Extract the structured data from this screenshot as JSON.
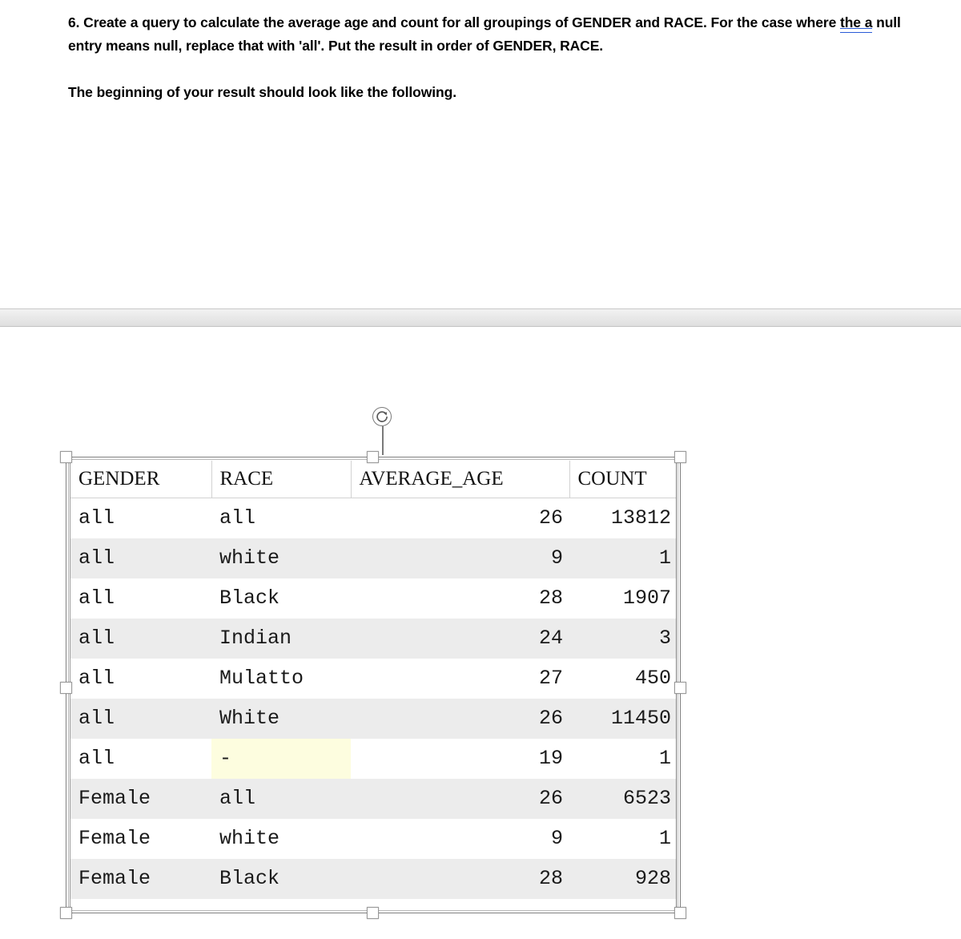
{
  "document": {
    "paragraph_1_part_a": "6.  Create a query to calculate the average age and count for all groupings of GENDER and RACE.  For the case where ",
    "grammar_flagged_text": "the a",
    "paragraph_1_part_b": " null entry means null, replace that with 'all'.  Put the result in order of GENDER, RACE.",
    "paragraph_2": "The beginning of your result should look like the following."
  },
  "selection": {
    "rotate_handle_label": "rotate-handle",
    "handles": [
      "top-left",
      "top-center",
      "top-right",
      "middle-left",
      "middle-right",
      "bottom-left",
      "bottom-center",
      "bottom-right"
    ]
  },
  "colors": {
    "null_highlight": "#fdfddf",
    "row_shade": "#ececec",
    "grammar_underline": "#2a5bd7",
    "selection_border": "#7f7f7f",
    "page_break_band": "#e7e7e7"
  },
  "table": {
    "columns": [
      "GENDER",
      "RACE",
      "AVERAGE_AGE",
      "COUNT"
    ],
    "rows": [
      {
        "gender": "all",
        "race": "all",
        "average_age": "26",
        "count": "13812",
        "race_null_highlight": false
      },
      {
        "gender": "all",
        "race": "white",
        "average_age": "9",
        "count": "1",
        "race_null_highlight": false
      },
      {
        "gender": "all",
        "race": "Black",
        "average_age": "28",
        "count": "1907",
        "race_null_highlight": false
      },
      {
        "gender": "all",
        "race": "Indian",
        "average_age": "24",
        "count": "3",
        "race_null_highlight": false
      },
      {
        "gender": "all",
        "race": "Mulatto",
        "average_age": "27",
        "count": "450",
        "race_null_highlight": false
      },
      {
        "gender": "all",
        "race": "White",
        "average_age": "26",
        "count": "11450",
        "race_null_highlight": false
      },
      {
        "gender": "all",
        "race": "-",
        "average_age": "19",
        "count": "1",
        "race_null_highlight": true
      },
      {
        "gender": "Female",
        "race": "all",
        "average_age": "26",
        "count": "6523",
        "race_null_highlight": false
      },
      {
        "gender": "Female",
        "race": "white",
        "average_age": "9",
        "count": "1",
        "race_null_highlight": false
      },
      {
        "gender": "Female",
        "race": "Black",
        "average_age": "28",
        "count": "928",
        "race_null_highlight": false
      }
    ]
  }
}
